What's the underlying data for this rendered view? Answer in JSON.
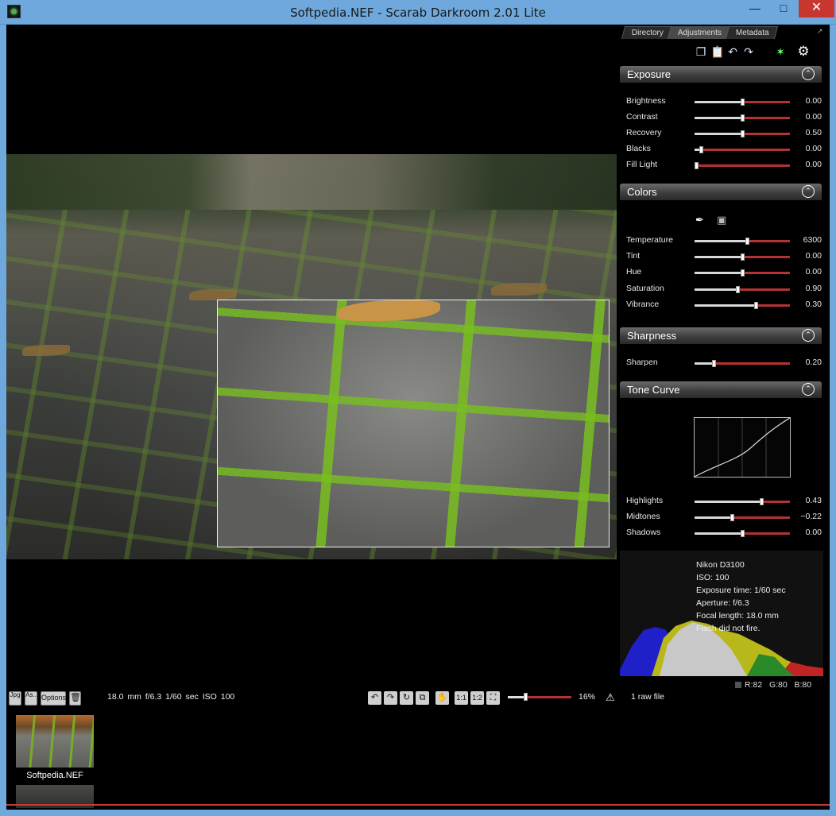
{
  "window": {
    "title": "Softpedia.NEF - Scarab Darkroom 2.01 Lite",
    "minimize": "—",
    "maximize": "□",
    "close": "✕"
  },
  "tabs": [
    "Directory",
    "Adjustments",
    "Metadata"
  ],
  "toolbar_icons": [
    "copy-icon",
    "paste-icon",
    "undo-icon",
    "redo-icon",
    "scarab-logo-icon",
    "gear-icon"
  ],
  "colors": {
    "titlebar": "#6fa8dc",
    "slider_track": "#b33232",
    "close_button": "#c7372f"
  },
  "exposure": {
    "title": "Exposure",
    "rows": [
      {
        "label": "Brightness",
        "value": "0.00",
        "pos": 0.5
      },
      {
        "label": "Contrast",
        "value": "0.00",
        "pos": 0.5
      },
      {
        "label": "Recovery",
        "value": "0.50",
        "pos": 0.5
      },
      {
        "label": "Blacks",
        "value": "0.00",
        "pos": 0.07
      },
      {
        "label": "Fill Light",
        "value": "0.00",
        "pos": 0.02
      }
    ]
  },
  "colors_section": {
    "title": "Colors",
    "tools": [
      "eyedropper-icon",
      "camera-wb-icon"
    ],
    "rows": [
      {
        "label": "Temperature",
        "value": "6300",
        "pos": 0.55
      },
      {
        "label": "Tint",
        "value": "0.00",
        "pos": 0.5
      },
      {
        "label": "Hue",
        "value": "0.00",
        "pos": 0.5
      },
      {
        "label": "Saturation",
        "value": "0.90",
        "pos": 0.45
      },
      {
        "label": "Vibrance",
        "value": "0.30",
        "pos": 0.64
      }
    ]
  },
  "sharpness": {
    "title": "Sharpness",
    "rows": [
      {
        "label": "Sharpen",
        "value": "0.20",
        "pos": 0.2
      }
    ]
  },
  "tone_curve": {
    "title": "Tone Curve",
    "rows": [
      {
        "label": "Highlights",
        "value": "0.43",
        "pos": 0.7
      },
      {
        "label": "Midtones",
        "value": "−0.22",
        "pos": 0.39
      },
      {
        "label": "Shadows",
        "value": "0.00",
        "pos": 0.5
      }
    ]
  },
  "histogram": {
    "info": [
      "Nikon D3100",
      "ISO: 100",
      "Exposure time: 1/60 sec",
      "Aperture: f/6.3",
      "Focal length: 18.0 mm",
      "Flash did not fire."
    ],
    "rgb": {
      "r": "R:82",
      "g": "G:80",
      "b": "B:80"
    }
  },
  "bottombar": {
    "btn_jpg": "Jpg",
    "btn_as": "As..",
    "btn_options": "Options",
    "exif": "18.0 mm   f/6.3   1/60 sec    ISO 100",
    "tool_1to1": "1:1",
    "tool_1to2": "1:2",
    "zoom": "16%",
    "zoom_pos": 0.27,
    "raw_count": "1 raw file"
  },
  "filmstrip": {
    "items": [
      {
        "label": "Softpedia.NEF"
      }
    ]
  }
}
